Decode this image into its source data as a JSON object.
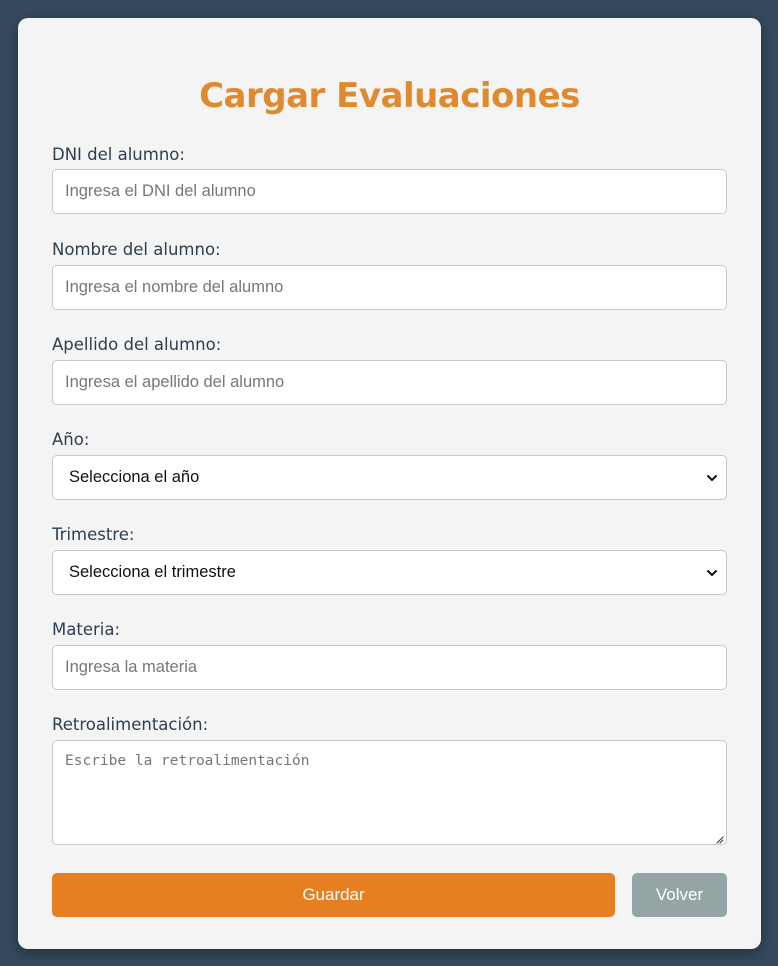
{
  "form": {
    "title": "Cargar Evaluaciones",
    "fields": {
      "dni": {
        "label": "DNI del alumno:",
        "placeholder": "Ingresa el DNI del alumno",
        "value": ""
      },
      "nombre": {
        "label": "Nombre del alumno:",
        "placeholder": "Ingresa el nombre del alumno",
        "value": ""
      },
      "apellido": {
        "label": "Apellido del alumno:",
        "placeholder": "Ingresa el apellido del alumno",
        "value": ""
      },
      "anio": {
        "label": "Año:",
        "selected": "Selecciona el año"
      },
      "trimestre": {
        "label": "Trimestre:",
        "selected": "Selecciona el trimestre"
      },
      "materia": {
        "label": "Materia:",
        "placeholder": "Ingresa la materia",
        "value": ""
      },
      "retroalimentacion": {
        "label": "Retroalimentación:",
        "placeholder": "Escribe la retroalimentación",
        "value": ""
      }
    },
    "buttons": {
      "save_label": "Guardar",
      "back_label": "Volver"
    }
  },
  "theme": {
    "background": "#34495e",
    "card": "#f4f4f4",
    "accent": "#e67e22",
    "title_color": "#e08a30",
    "secondary_button": "#95a5a6",
    "label_color": "#2c3e50"
  },
  "icons": {
    "select_arrow": "chevron-down-icon",
    "textarea_resize": "resize-grip-icon"
  }
}
